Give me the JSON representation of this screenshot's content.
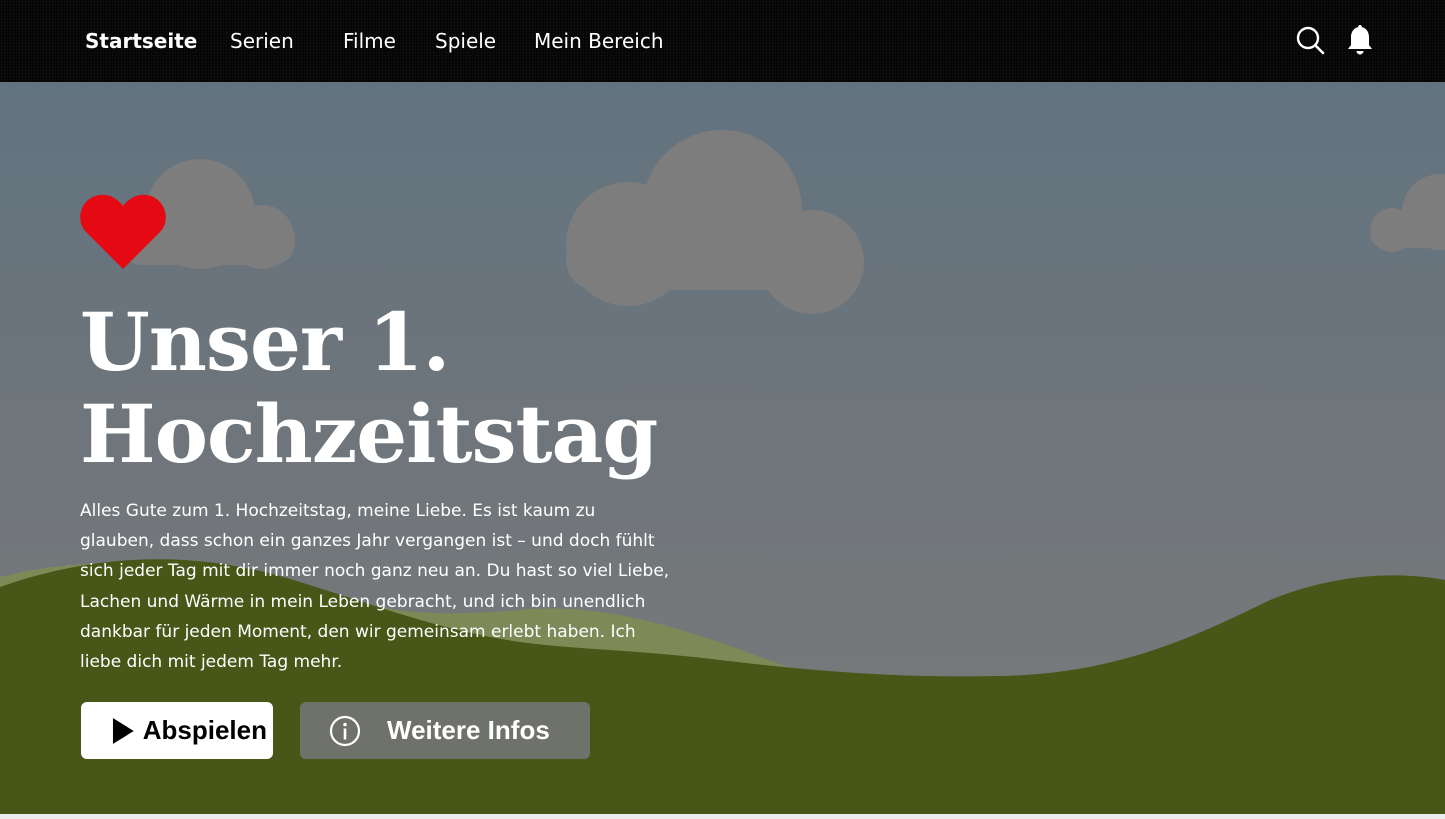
{
  "nav": {
    "items": [
      {
        "label": "Startseite",
        "active": true
      },
      {
        "label": "Serien",
        "active": false
      },
      {
        "label": "Filme",
        "active": false
      },
      {
        "label": "Spiele",
        "active": false
      },
      {
        "label": "Mein Bereich",
        "active": false
      }
    ],
    "icons": [
      "search-icon",
      "bell-icon"
    ]
  },
  "hero": {
    "title_line1": "Unser 1.",
    "title_line2": "Hochzeitstag",
    "description": "Alles Gute zum 1. Hochzeitstag, meine Liebe. Es ist kaum zu glauben, dass schon ein ganzes Jahr vergangen ist – und doch fühlt sich jeder Tag mit dir immer noch ganz neu an. Du hast so viel Liebe, Lachen und Wärme in mein Leben gebracht, und ich bin unendlich dankbar für jeden Moment, den wir gemeinsam erlebt haben. Ich liebe dich mit jedem Tag mehr.",
    "play_label": "Abspielen",
    "info_label": "Weitere Infos",
    "icons": [
      "heart-icon",
      "play-icon",
      "info-icon"
    ]
  },
  "colors": {
    "nav_background": "#050505",
    "heart": "#e50914",
    "sky": "#6b7680",
    "hills_front": "#485618",
    "hills_back": "#7a8a4a",
    "cloud": "#7d7d7d"
  }
}
